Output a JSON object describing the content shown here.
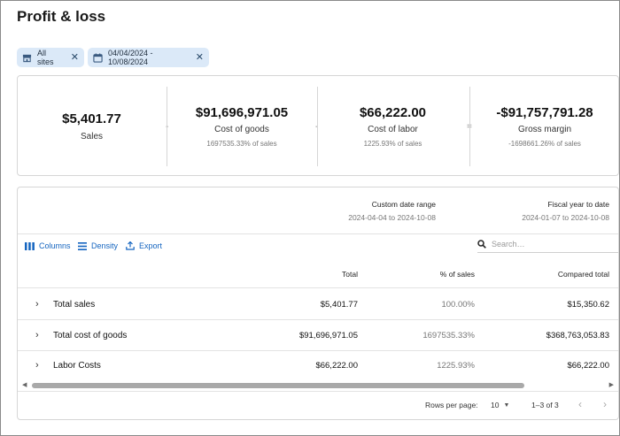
{
  "page": {
    "title": "Profit & loss"
  },
  "filters": [
    {
      "label": "All sites",
      "icon": "store-icon"
    },
    {
      "label": "04/04/2024 - 10/08/2024",
      "icon": "calendar-icon"
    }
  ],
  "summary": {
    "sales": {
      "value": "$5,401.77",
      "label": "Sales"
    },
    "cost_of_goods": {
      "value": "$91,696,971.05",
      "label": "Cost of goods",
      "sub": "1697535.33% of sales"
    },
    "cost_of_labor": {
      "value": "$66,222.00",
      "label": "Cost of labor",
      "sub": "1225.93% of sales"
    },
    "gross_margin": {
      "value": "-$91,757,791.28",
      "label": "Gross margin",
      "sub": "-1698661.26% of sales"
    },
    "operators": [
      "-",
      "-",
      "="
    ]
  },
  "table": {
    "column_groups": [
      {
        "title": "Custom date range",
        "range": "2024-04-04 to 2024-10-08"
      },
      {
        "title": "Fiscal year to date",
        "range": "2024-01-07 to 2024-10-08"
      }
    ],
    "toolbar": {
      "columns": "Columns",
      "density": "Density",
      "export": "Export"
    },
    "search_placeholder": "Search…",
    "headers": {
      "total": "Total",
      "pct_sales": "% of sales",
      "compared_total": "Compared total"
    },
    "rows": [
      {
        "name": "Total sales",
        "total": "$5,401.77",
        "pct_sales": "100.00%",
        "compared_total": "$15,350.62"
      },
      {
        "name": "Total cost of goods",
        "total": "$91,696,971.05",
        "pct_sales": "1697535.33%",
        "compared_total": "$368,763,053.83"
      },
      {
        "name": "Labor Costs",
        "total": "$66,222.00",
        "pct_sales": "1225.93%",
        "compared_total": "$66,222.00"
      }
    ],
    "pagination": {
      "rows_per_page_label": "Rows per page:",
      "rows_per_page": "10",
      "range": "1–3 of 3"
    }
  },
  "colors": {
    "accent": "#1565c0",
    "chip_bg": "#dbe9f8",
    "muted": "#9a9a9a"
  }
}
